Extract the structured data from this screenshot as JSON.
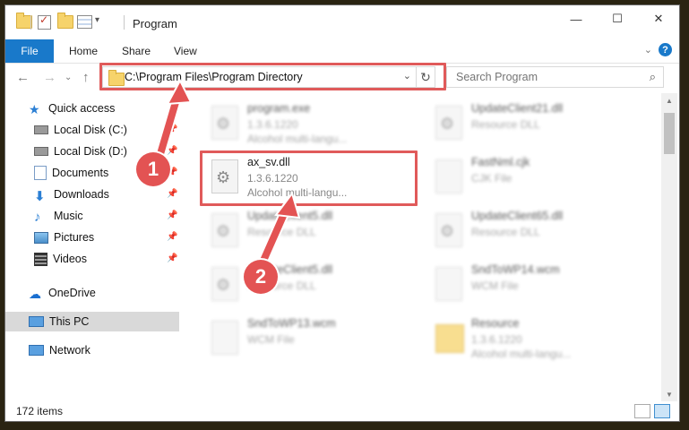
{
  "window": {
    "title": "Program",
    "controls": {
      "minimize": "—",
      "maximize": "☐",
      "close": "✕"
    }
  },
  "ribbon": {
    "tabs": [
      "File",
      "Home",
      "Share",
      "View"
    ],
    "help": "?",
    "collapse": "⌄"
  },
  "nav": {
    "back": "←",
    "forward": "→",
    "recent": "⌄",
    "up": "↑",
    "address": "C:\\Program Files\\Program Directory",
    "address_dropdown": "⌄",
    "refresh": "↻",
    "search_placeholder": "Search Program",
    "search_icon": "magnifier-icon"
  },
  "sidebar": {
    "items": [
      {
        "label": "Quick access",
        "icon": "star-icon",
        "pinned": false,
        "selected": false
      },
      {
        "label": "Local Disk (C:)",
        "icon": "drive-icon",
        "pinned": true,
        "selected": false
      },
      {
        "label": "Local Disk (D:)",
        "icon": "drive-icon",
        "pinned": true,
        "selected": false
      },
      {
        "label": "Documents",
        "icon": "documents-icon",
        "pinned": true,
        "selected": false
      },
      {
        "label": "Downloads",
        "icon": "download-icon",
        "pinned": true,
        "selected": false
      },
      {
        "label": "Music",
        "icon": "music-icon",
        "pinned": true,
        "selected": false
      },
      {
        "label": "Pictures",
        "icon": "pictures-icon",
        "pinned": true,
        "selected": false
      },
      {
        "label": "Videos",
        "icon": "videos-icon",
        "pinned": true,
        "selected": false
      },
      {
        "label": "OneDrive",
        "icon": "cloud-icon",
        "pinned": false,
        "selected": false
      },
      {
        "label": "This PC",
        "icon": "computer-icon",
        "pinned": false,
        "selected": true
      },
      {
        "label": "Network",
        "icon": "network-icon",
        "pinned": false,
        "selected": false
      }
    ]
  },
  "files": [
    {
      "name": "program.exe",
      "line1": "1.3.6.1220",
      "line2": "Alcohol multi-langu...",
      "icon": "exe-icon",
      "blurred": true
    },
    {
      "name": "UpdateClient21.dll",
      "line1": "Resource DLL",
      "line2": "",
      "icon": "dll-gear-icon",
      "blurred": true
    },
    {
      "name": "ax_sv.dll",
      "line1": "1.3.6.1220",
      "line2": "Alcohol multi-langu...",
      "icon": "dll-gear-icon",
      "blurred": false
    },
    {
      "name": "FastNml.cjk",
      "line1": "CJK File",
      "line2": "",
      "icon": "file-icon",
      "blurred": true
    },
    {
      "name": "UpdateClient5.dll",
      "line1": "Resource DLL",
      "line2": "",
      "icon": "dll-gear-icon",
      "blurred": true
    },
    {
      "name": "UpdateClient65.dll",
      "line1": "Resource DLL",
      "line2": "",
      "icon": "dll-gear-icon",
      "blurred": true
    },
    {
      "name": "UpdateClient5.dll",
      "line1": "Resource DLL",
      "line2": "",
      "icon": "dll-gear-icon",
      "blurred": true
    },
    {
      "name": "SndToWP14.wcm",
      "line1": "WCM File",
      "line2": "",
      "icon": "file-icon",
      "blurred": true
    },
    {
      "name": "SndToWP13.wcm",
      "line1": "WCM File",
      "line2": "",
      "icon": "file-icon",
      "blurred": true
    },
    {
      "name": "Resource",
      "line1": "1.3.6.1220",
      "line2": "Alcohol multi-langu...",
      "icon": "folder-icon",
      "blurred": true
    }
  ],
  "status": {
    "count": "172 items"
  },
  "annotations": {
    "step1": "1",
    "step2": "2"
  },
  "colors": {
    "accent": "#1979ca",
    "highlight": "#e05a5a",
    "selected": "#d9d9d9"
  }
}
